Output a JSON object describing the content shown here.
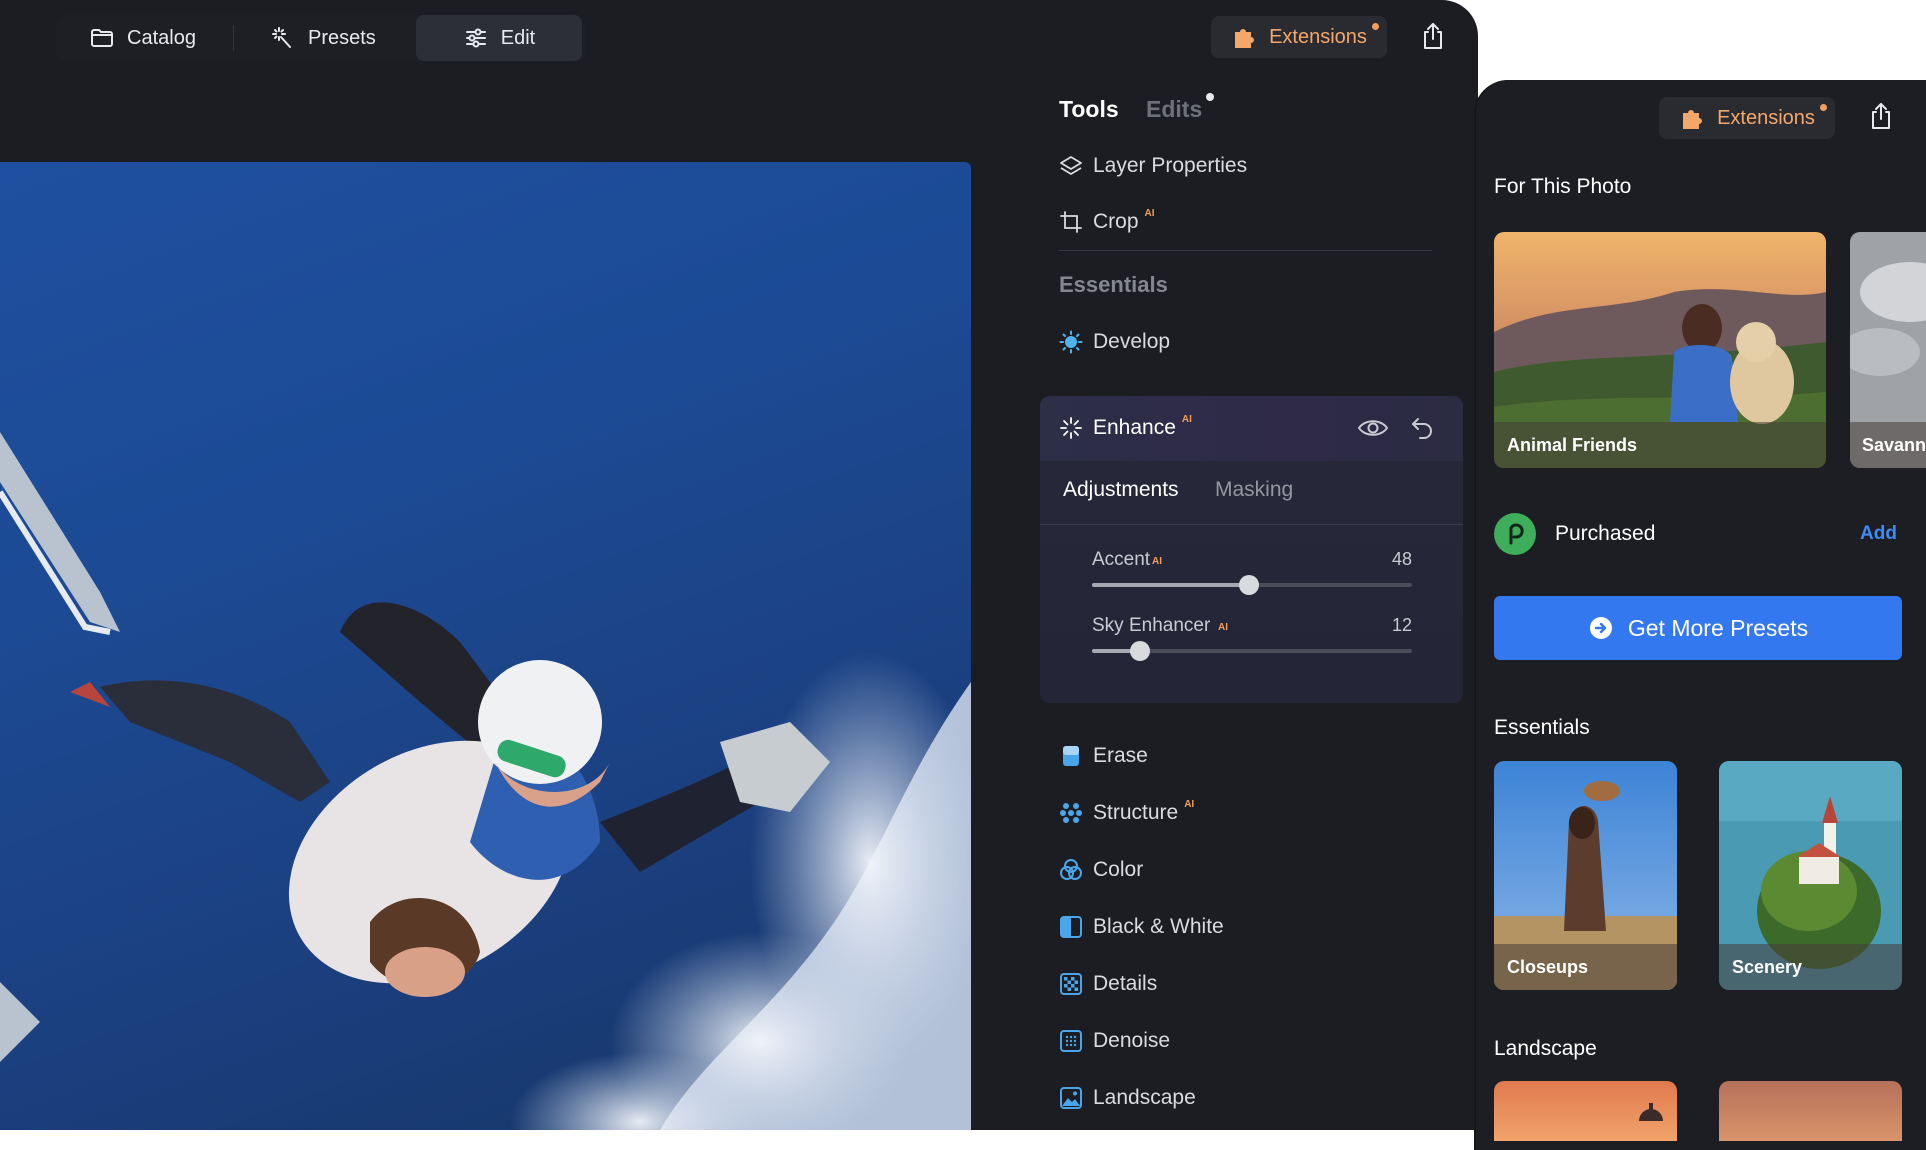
{
  "toolbar": {
    "catalog_label": "Catalog",
    "presets_label": "Presets",
    "edit_label": "Edit",
    "extensions_label": "Extensions",
    "icons": [
      "folder-icon",
      "magic-wand-icon",
      "sliders-icon",
      "puzzle-icon",
      "share-icon"
    ]
  },
  "panel": {
    "tabs": [
      {
        "label": "Tools",
        "active": true
      },
      {
        "label": "Edits",
        "active": false,
        "has_dot": true
      }
    ],
    "top_tools": [
      {
        "label": "Layer Properties",
        "icon": "layers-icon"
      },
      {
        "label": "Crop",
        "icon": "crop-icon",
        "ai": "AI"
      }
    ],
    "essentials_heading": "Essentials",
    "develop_label": "Develop",
    "enhance": {
      "title": "Enhance",
      "ai": "AI",
      "subtabs": [
        "Adjustments",
        "Masking"
      ],
      "sliders": [
        {
          "label": "Accent",
          "ai": "AI",
          "value": 48,
          "fraction": 0.49
        },
        {
          "label": "Sky Enhancer",
          "ai": "AI",
          "value": 12,
          "fraction": 0.15
        }
      ]
    },
    "tools": [
      {
        "label": "Erase",
        "icon": "eraser-icon"
      },
      {
        "label": "Structure",
        "icon": "structure-icon",
        "ai": "AI"
      },
      {
        "label": "Color",
        "icon": "color-circles-icon"
      },
      {
        "label": "Black & White",
        "icon": "half-square-icon"
      },
      {
        "label": "Details",
        "icon": "checker-icon"
      },
      {
        "label": "Denoise",
        "icon": "dotted-square-icon"
      },
      {
        "label": "Landscape",
        "icon": "landscape-icon"
      }
    ]
  },
  "extensions_window": {
    "extensions_label": "Extensions",
    "for_this_photo_heading": "For This Photo",
    "photo_presets": [
      "Animal Friends",
      "Savann"
    ],
    "purchased_label": "Purchased",
    "add_label": "Add",
    "cta_label": "Get More Presets",
    "essentials_heading": "Essentials",
    "essentials_items": [
      "Closeups",
      "Scenery"
    ],
    "landscape_heading": "Landscape"
  },
  "colors": {
    "accent_orange": "#f3a86b",
    "accent_blue": "#3478f0",
    "ai_badge": "#f0a05c"
  }
}
